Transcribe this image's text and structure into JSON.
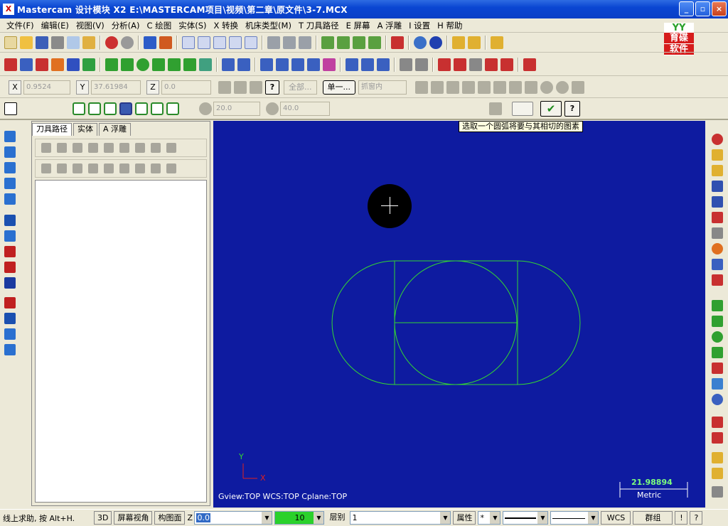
{
  "window": {
    "app_icon": "X",
    "title": "Mastercam 设计模块   X2   E:\\MASTERCAM项目\\视频\\第二章\\原文件\\3-7.MCX",
    "minimize": "_",
    "maximize": "▫",
    "close": "×"
  },
  "menu": [
    "文件(F)",
    "编辑(E)",
    "视图(V)",
    "分析(A)",
    "C 绘图",
    "实体(S)",
    "X 转换",
    "机床类型(M)",
    "T 刀具路径",
    "E 屏幕",
    "A 浮雕",
    "I 设置",
    "H 帮助"
  ],
  "logo": {
    "top": "YY",
    "line1": "育碟",
    "line2": "软件"
  },
  "coord_bar": {
    "x_label": "X",
    "x_value": "0.9524",
    "y_label": "Y",
    "y_value": "37.61984",
    "z_label": "Z",
    "z_value": "0.0",
    "all_button": "全部...",
    "single_button": "单一...",
    "filter_value": "抓窗内"
  },
  "arc_bar": {
    "radius": "20.0",
    "diameter": "40.0"
  },
  "panel": {
    "tabs": [
      "刀具路径",
      "实体",
      "A 浮雕"
    ]
  },
  "viewport": {
    "tooltip": "选取一个圆弧将要与其相切的图素",
    "axis_y": "Y",
    "axis_x": "X",
    "view_info": "Gview:TOP   WCS:TOP   Cplane:TOP",
    "scale_value": "21.98894",
    "scale_unit": "Metric",
    "background": "#0e1ba0",
    "geometry_color": "#33d633"
  },
  "status": {
    "help": "线上求助, 按 Alt+H.",
    "mode_3d": "3D",
    "screen_view": "屏幕视角",
    "cplane": "构图面",
    "z_label": "Z",
    "z_value": "0.0",
    "level_value": "10",
    "layer_label": "层别",
    "layer_value": "1",
    "attributes": "属性",
    "wcs": "WCS",
    "group": "群组",
    "help_btn": "!",
    "question": "?"
  }
}
